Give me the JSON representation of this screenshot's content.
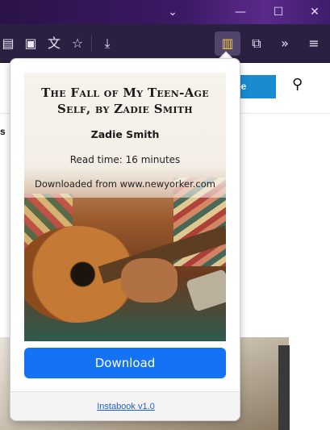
{
  "browser": {
    "window_controls": [
      "chevron-down-icon",
      "minimize-icon",
      "maximize-icon",
      "close-icon"
    ],
    "toolbar_icons": [
      "reader-view-icon",
      "screenshot-icon",
      "translate-icon",
      "bookmark-star-icon",
      "download-icon",
      "instabook-book-icon",
      "extensions-puzzle-icon",
      "overflow-chevrons-icon",
      "hamburger-menu-icon"
    ]
  },
  "page": {
    "subscribe_label": "ibe",
    "left_fragment": "s"
  },
  "popup": {
    "cover": {
      "title": "The Fall of My Teen-Age Self, by Zadie Smith",
      "author": "Zadie Smith",
      "read_time": "Read time: 16 minutes",
      "source": "Downloaded from www.newyorker.com"
    },
    "download_label": "Download",
    "footer_link": "Instabook v1.0"
  },
  "colors": {
    "titlebar": "#3b1a64",
    "toolbar": "#2b2042",
    "accent_button": "#1473f5",
    "subscribe": "#1b8ad0",
    "link": "#1a5fd0"
  }
}
